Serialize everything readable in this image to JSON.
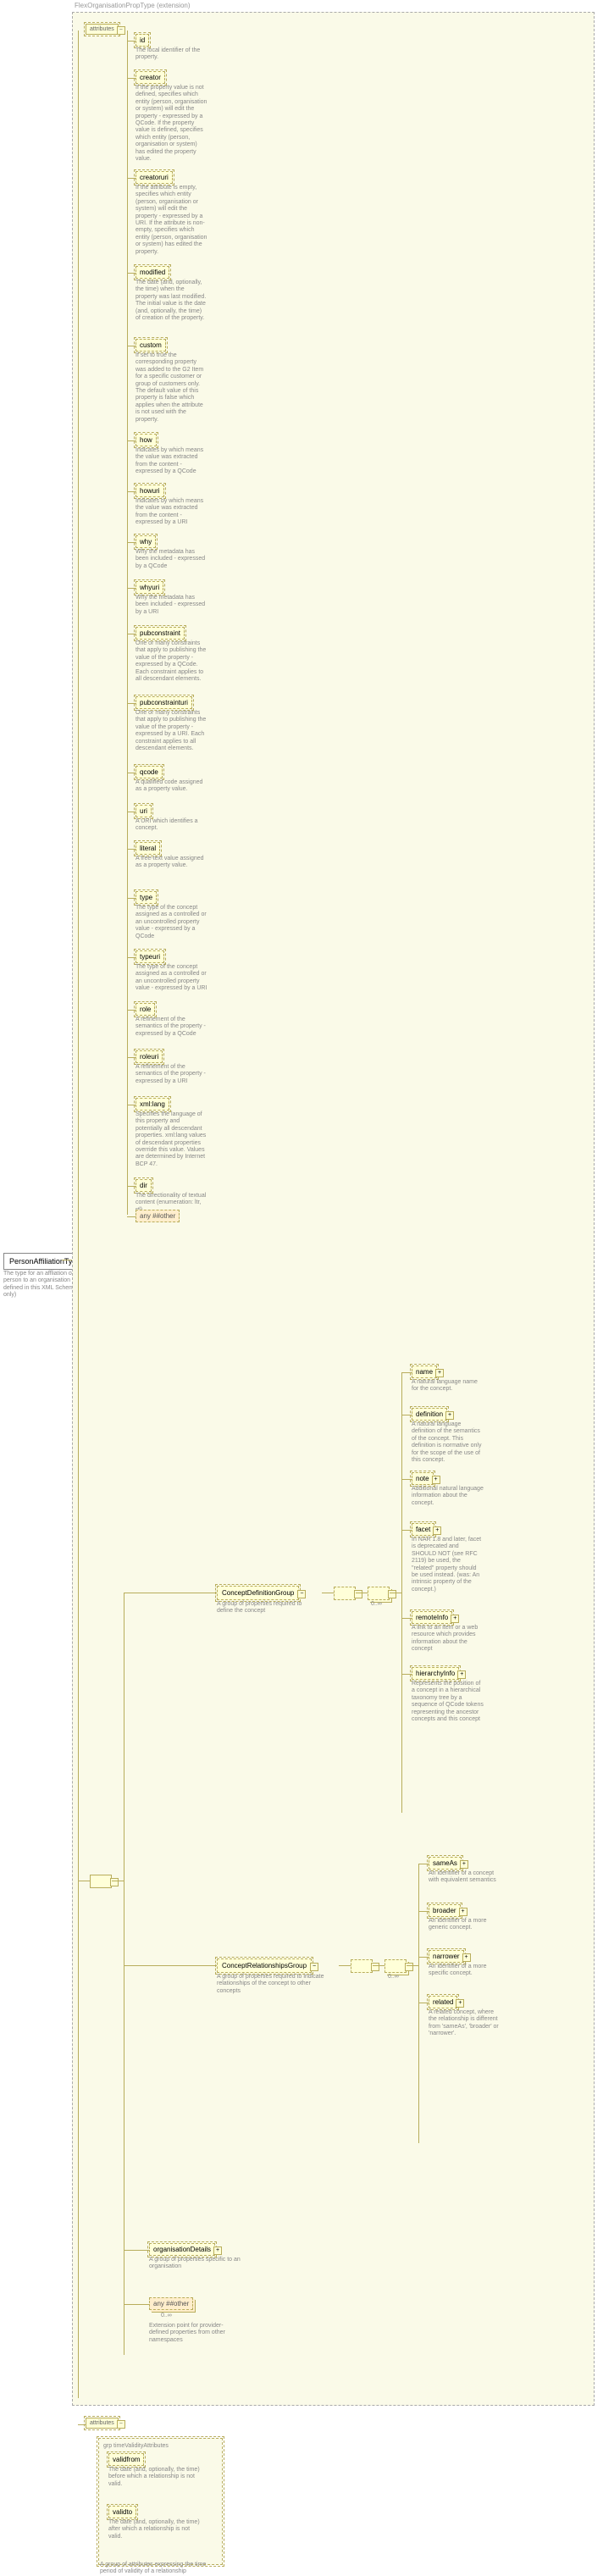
{
  "root": {
    "name": "PersonAffiliationType",
    "desc": "The type for an affliation of a person to an organisation (Type defined in this XML Schema only)"
  },
  "extension": {
    "label": "FlexOrganisationPropType (extension)"
  },
  "attrsLabel": "attributes",
  "attrs": [
    {
      "name": "id",
      "desc": "The local identifier of the property."
    },
    {
      "name": "creator",
      "desc": "If the property value is not defined, specifies which entity (person, organisation or system) will edit the property - expressed by a QCode. If the property value is defined, specifies which entity (person, organisation or system) has edited the property value."
    },
    {
      "name": "creatoruri",
      "desc": "If the attribute is empty, specifies which entity (person, organisation or system) will edit the property - expressed by a URI. If the attribute is non-empty, specifies which entity (person, organisation or system) has edited the property."
    },
    {
      "name": "modified",
      "desc": "The date (and, optionally, the time) when the property was last modified. The initial value is the date (and, optionally, the time) of creation of the property."
    },
    {
      "name": "custom",
      "desc": "If set to true the corresponding property was added to the G2 Item for a specific customer or group of customers only. The default value of this property is false which applies when the attribute is not used with the property."
    },
    {
      "name": "how",
      "desc": "Indicates by which means the value was extracted from the content - expressed by a QCode"
    },
    {
      "name": "howuri",
      "desc": "Indicates by which means the value was extracted from the content - expressed by a URI"
    },
    {
      "name": "why",
      "desc": "Why the metadata has been included - expressed by a QCode"
    },
    {
      "name": "whyuri",
      "desc": "Why the metadata has been included - expressed by a URI"
    },
    {
      "name": "pubconstraint",
      "desc": "One or many constraints that apply to publishing the value of the property - expressed by a QCode. Each constraint applies to all descendant elements."
    },
    {
      "name": "pubconstrainturi",
      "desc": "One or many constraints that apply to publishing the value of the property - expressed by a URI. Each constraint applies to all descendant elements."
    },
    {
      "name": "qcode",
      "desc": "A qualified code assigned as a property value."
    },
    {
      "name": "uri",
      "desc": "A URI which identifies a concept."
    },
    {
      "name": "literal",
      "desc": "A free-text value assigned as a property value."
    },
    {
      "name": "type",
      "desc": "The type of the concept assigned as a controlled or an uncontrolled property value - expressed by a QCode"
    },
    {
      "name": "typeuri",
      "desc": "The type of the concept assigned as a controlled or an uncontrolled property value - expressed by a URI"
    },
    {
      "name": "role",
      "desc": "A refinement of the semantics of the property - expressed by a QCode"
    },
    {
      "name": "roleuri",
      "desc": "A refinement of the semantics of the property - expressed by a URI"
    },
    {
      "name": "xml:lang",
      "desc": "Specifies the language of this property and potentially all descendant properties. xml:lang values of descendant properties override this value. Values are determined by Internet BCP 47."
    },
    {
      "name": "dir",
      "desc": "The directionality of textual content (enumeration: ltr, rtl)"
    }
  ],
  "anyAttr": "any ##other",
  "groups": {
    "conceptDef": {
      "name": "ConceptDefinitionGroup",
      "desc": "A group of properties required to define the concept",
      "children": [
        {
          "name": "name",
          "desc": "A natural language name for the concept."
        },
        {
          "name": "definition",
          "desc": "A natural language definition of the semantics of the concept. This definition is normative only for the scope of the use of this concept."
        },
        {
          "name": "note",
          "desc": "Additional natural language information about the concept."
        },
        {
          "name": "facet",
          "desc": "In NAR 1.8 and later, facet is deprecated and SHOULD NOT (see RFC 2119) be used, the \"related\" property should be used instead. (was: An intrinsic property of the concept.)"
        },
        {
          "name": "remoteInfo",
          "desc": "A link to an item or a web resource which provides information about the concept"
        },
        {
          "name": "hierarchyInfo",
          "desc": "Represents the position of a concept in a hierarchical taxonomy tree by a sequence of QCode tokens representing the ancestor concepts and this concept"
        }
      ]
    },
    "conceptRel": {
      "name": "ConceptRelationshipsGroup",
      "desc": "A group of properties required to indicate relationships of the concept to other concepts",
      "children": [
        {
          "name": "sameAs",
          "desc": "An identifier of a concept with equivalent semantics"
        },
        {
          "name": "broader",
          "desc": "An identifier of a more generic concept."
        },
        {
          "name": "narrower",
          "desc": "An identifier of a more specific concept."
        },
        {
          "name": "related",
          "desc": "A related concept, where the relationship is different from 'sameAs', 'broader' or 'narrower'."
        }
      ]
    },
    "orgDetails": {
      "name": "organisationDetails",
      "desc": "A group of properties specific to an organisation"
    },
    "anyOther": {
      "name": "any ##other",
      "desc": "Extension point for provider-defined properties from other namespaces"
    }
  },
  "cards": {
    "zeroUnbounded": "0..∞"
  },
  "timeValidity": {
    "grpLabel": "grp timeValidityAttributes",
    "attrs": [
      {
        "name": "validfrom",
        "desc": "The date (and, optionally, the time) before which a relationship is not valid."
      },
      {
        "name": "validto",
        "desc": "The date (and, optionally, the time) after which a relationship is not valid."
      }
    ],
    "desc": "A group of attributes expressing the time period of validity of a relationship"
  }
}
